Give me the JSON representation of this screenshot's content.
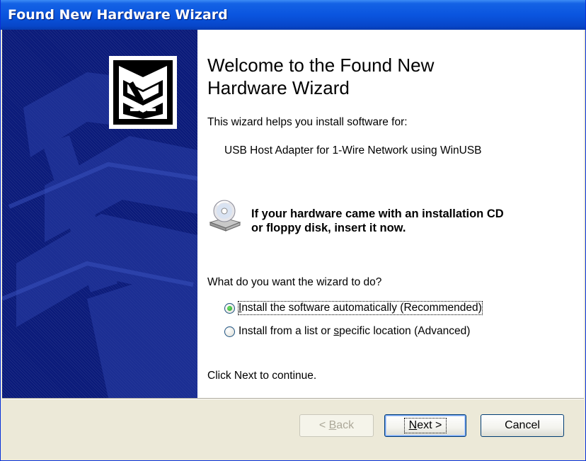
{
  "window": {
    "title": "Found New Hardware Wizard"
  },
  "main": {
    "heading_line1": "Welcome to the Found New",
    "heading_line2": "Hardware Wizard",
    "intro": "This wizard helps you install software for:",
    "device": "USB Host Adapter for 1-Wire Network using WinUSB",
    "cd_line1": "If your hardware came with an installation CD",
    "cd_line2": "or floppy disk, insert it now.",
    "question": "What do you want the wizard to do?",
    "options": [
      {
        "before": "",
        "key": "I",
        "after": "nstall the software automatically (Recommended)",
        "selected": true
      },
      {
        "before": "Install from a list or ",
        "key": "s",
        "after": "pecific location (Advanced)",
        "selected": false
      }
    ],
    "continue_text": "Click Next to continue."
  },
  "buttons": {
    "back": {
      "prefix": "< ",
      "key": "B",
      "rest": "ack",
      "enabled": false
    },
    "next": {
      "key": "N",
      "rest": "ext >",
      "default": true
    },
    "cancel": {
      "label": "Cancel"
    }
  },
  "icons": {
    "hardware": "hardware-box-icon",
    "cd": "cd-drive-icon"
  },
  "colors": {
    "titlebar": "#0a55df",
    "sidebar": "#0a1a7a",
    "radio_selected": "#21a121",
    "dialog_face": "#ece9d8"
  }
}
